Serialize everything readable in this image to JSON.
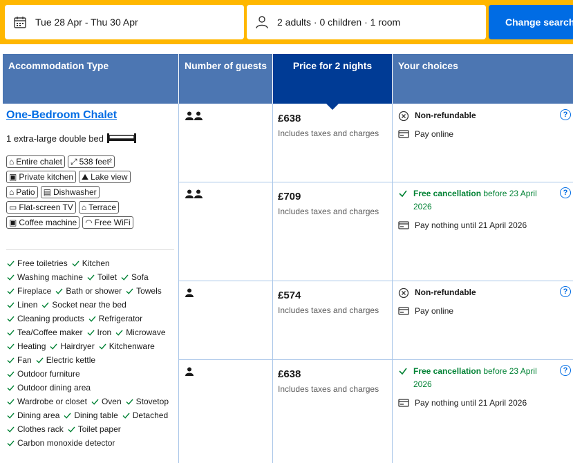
{
  "search": {
    "dates": "Tue 28 Apr - Thu 30 Apr",
    "guests": "2 adults · 0 children · 1 room",
    "button": "Change search"
  },
  "table": {
    "headers": {
      "type": "Accommodation Type",
      "guests": "Number of guests",
      "price": "Price for 2 nights",
      "choices": "Your choices"
    }
  },
  "room": {
    "name": "One-Bedroom Chalet",
    "bed": "1 extra-large double bed",
    "tags": [
      [
        "Entire chalet",
        "538 feet²"
      ],
      [
        "Private kitchen",
        "Lake view"
      ],
      [
        "Patio",
        "Dishwasher"
      ],
      [
        "Flat-screen TV",
        "Terrace"
      ],
      [
        "Coffee machine",
        "Free WiFi"
      ]
    ],
    "facilities": [
      [
        "Free toiletries",
        "Kitchen"
      ],
      [
        "Washing machine",
        "Toilet",
        "Sofa"
      ],
      [
        "Fireplace",
        "Bath or shower",
        "Towels"
      ],
      [
        "Linen",
        "Socket near the bed"
      ],
      [
        "Cleaning products",
        "Refrigerator"
      ],
      [
        "Tea/Coffee maker",
        "Iron",
        "Microwave"
      ],
      [
        "Heating",
        "Hairdryer",
        "Kitchenware"
      ],
      [
        "Fan",
        "Electric kettle"
      ],
      [
        "Outdoor furniture"
      ],
      [
        "Outdoor dining area"
      ],
      [
        "Wardrobe or closet",
        "Oven",
        "Stovetop"
      ],
      [
        "Dining area",
        "Dining table",
        "Detached"
      ],
      [
        "Clothes rack",
        "Toilet paper"
      ],
      [
        "Carbon monoxide detector"
      ]
    ]
  },
  "options": [
    {
      "guests": 2,
      "price": "£638",
      "note": "Includes taxes and charges",
      "policy": "Non-refundable",
      "policy_extra": "",
      "payment": "Pay online"
    },
    {
      "guests": 2,
      "price": "£709",
      "note": "Includes taxes and charges",
      "policy": "Free cancellation",
      "policy_extra": " before 23 April 2026",
      "payment": "Pay nothing until 21 April 2026"
    },
    {
      "guests": 1,
      "price": "£574",
      "note": "Includes taxes and charges",
      "policy": "Non-refundable",
      "policy_extra": "",
      "payment": "Pay online"
    },
    {
      "guests": 1,
      "price": "£638",
      "note": "Includes taxes and charges",
      "policy": "Free cancellation",
      "policy_extra": " before 23 April 2026",
      "payment": "Pay nothing until 21 April 2026"
    }
  ],
  "colors": {
    "brand_blue": "#006ce4",
    "header_blue": "#4c76b2",
    "selected_header": "#003b95",
    "search_yellow": "#ffb700",
    "green": "#008234"
  }
}
